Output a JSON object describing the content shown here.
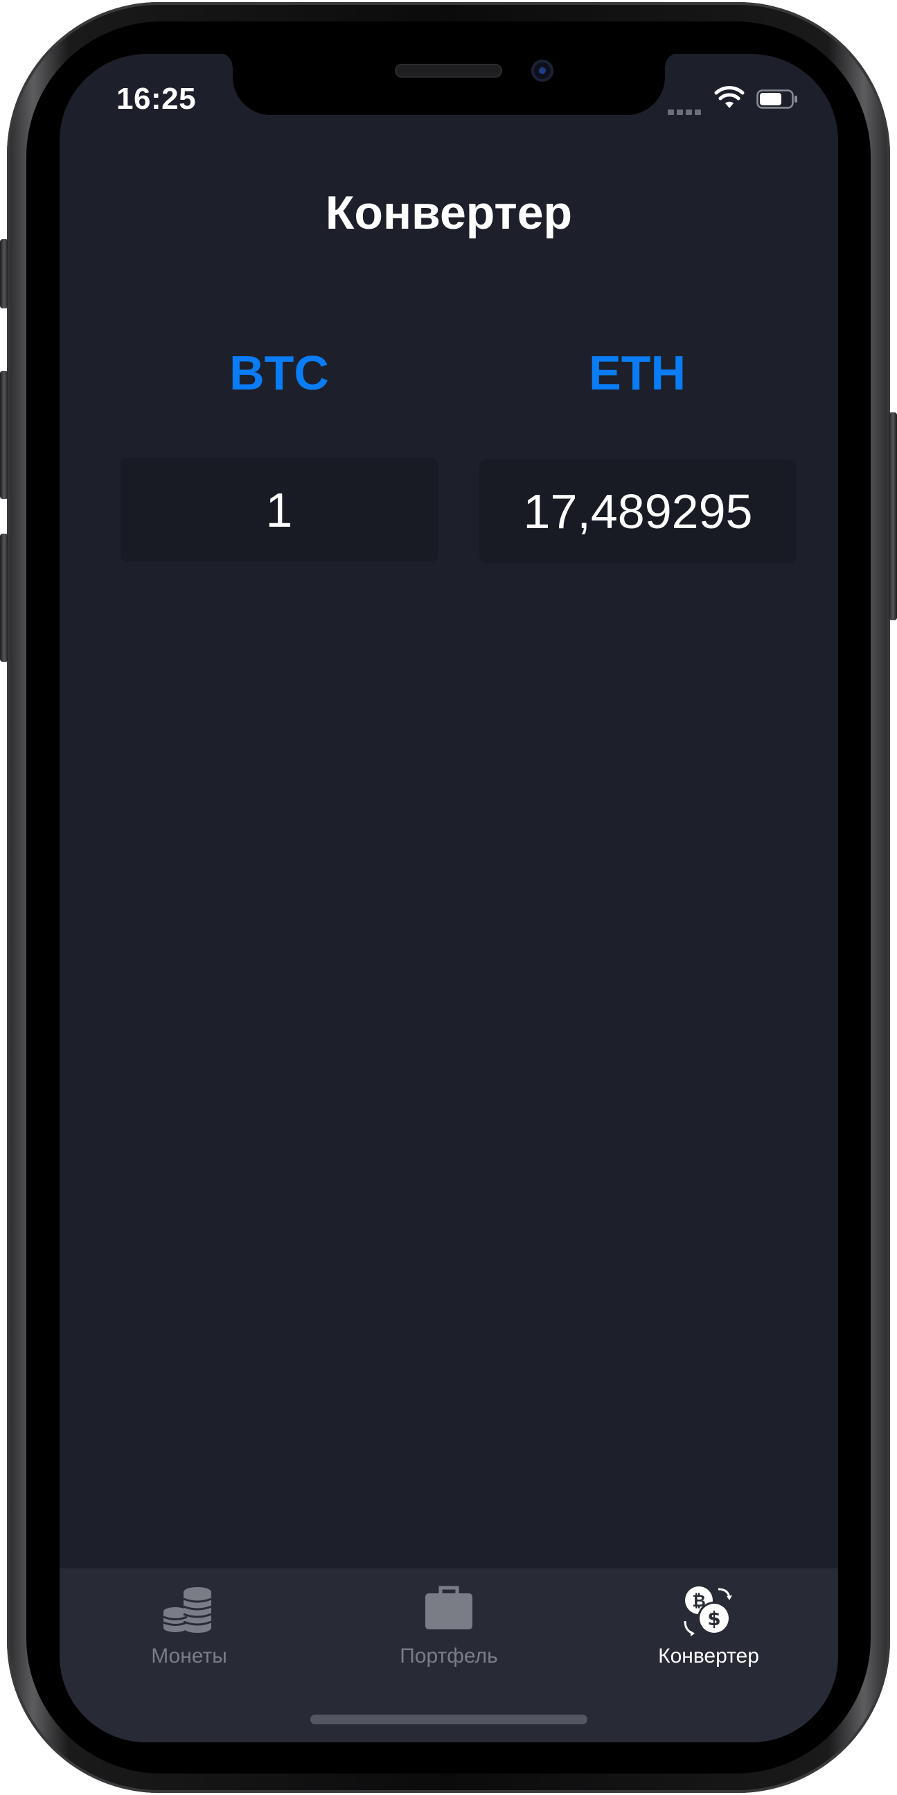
{
  "status_bar": {
    "time": "16:25"
  },
  "header": {
    "title": "Конвертер"
  },
  "converter": {
    "from_currency": "BTC",
    "to_currency": "ETH",
    "from_value": "1",
    "to_value": "17,489295",
    "accent_color": "#0a7cf5"
  },
  "tab_bar": {
    "tabs": [
      {
        "label": "Монеты",
        "icon": "coins-icon",
        "selected": false
      },
      {
        "label": "Портфель",
        "icon": "briefcase-icon",
        "selected": false
      },
      {
        "label": "Конвертер",
        "icon": "currency-exchange-icon",
        "selected": true
      }
    ]
  }
}
